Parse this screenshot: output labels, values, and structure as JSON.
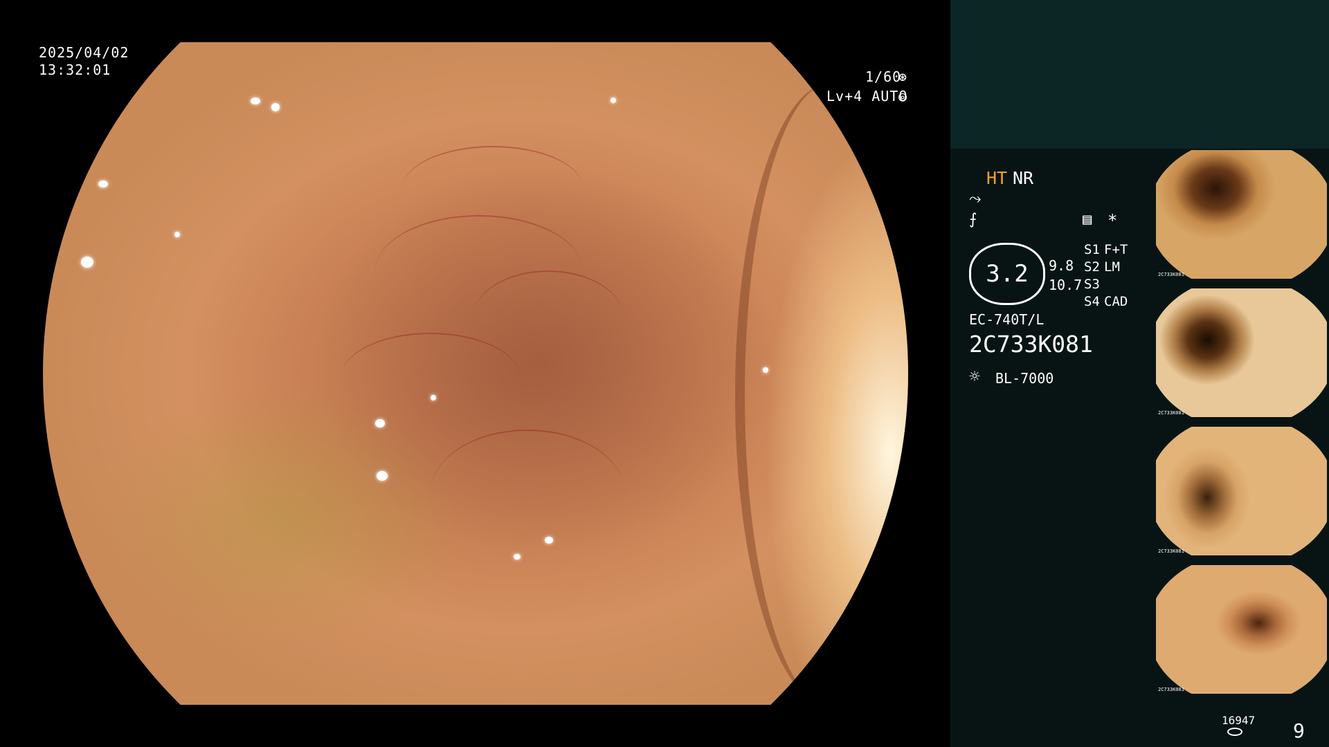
{
  "overlay": {
    "date": "2025/04/02",
    "time": "13:32:01",
    "shutter": "1/60",
    "shutter_icon": "⊛",
    "level_mode": "Lv+4 AUTO",
    "iris_icon": "◎"
  },
  "panel": {
    "ht": "HT",
    "nr": "NR",
    "icon_wave": "⤳",
    "icon_filter": "⨍",
    "menu_icon": "▤",
    "asterisk": "*",
    "zoom_value": "3.2",
    "value_a": "9.8",
    "value_b": "10.7",
    "switches": [
      {
        "key": "S1",
        "value": "F+T"
      },
      {
        "key": "S2",
        "value": "LM"
      },
      {
        "key": "S3",
        "value": ""
      },
      {
        "key": "S4",
        "value": "CAD"
      }
    ],
    "scope_model": "EC-740T/L",
    "serial": "2C733K081",
    "light_source": "BL-7000",
    "light_icon": "☼",
    "storage_count": "16947",
    "page_number": "9"
  },
  "thumbnails": [
    {
      "caption": "2C733K081"
    },
    {
      "caption": "2C733K081"
    },
    {
      "caption": "2C733K081"
    },
    {
      "caption": "2C733K081"
    }
  ],
  "colors": {
    "accent_ht": "#f0a030",
    "panel_bg": "#081414",
    "panel_top": "#0c2626"
  }
}
